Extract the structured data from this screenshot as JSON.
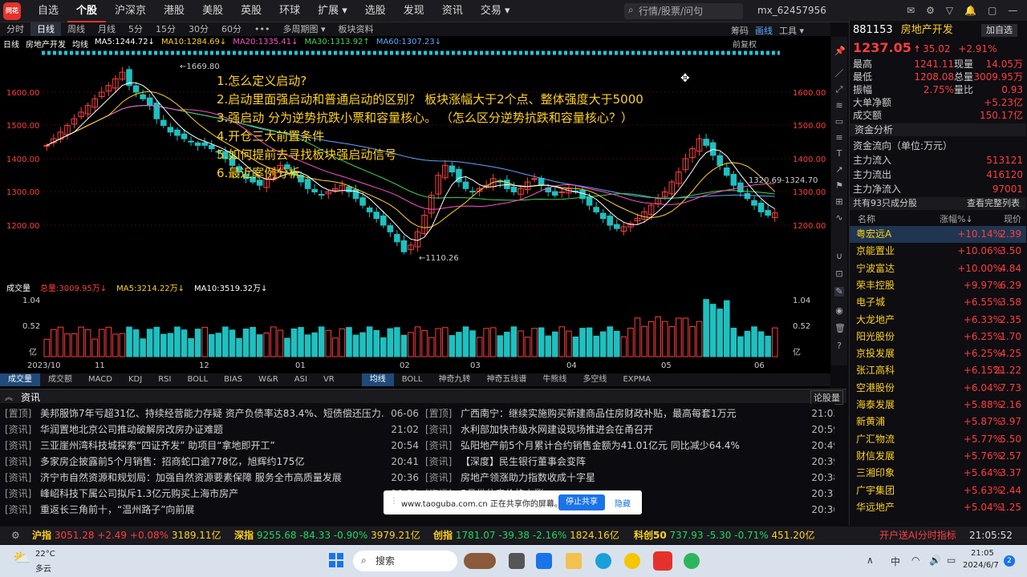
{
  "topbar": {
    "logo": "同花顺",
    "nav": [
      "自选",
      "个股",
      "沪深京",
      "港股",
      "美股",
      "英股",
      "环球",
      "扩展 ▾",
      "选股",
      "发现",
      "资讯",
      "交易 ▾"
    ],
    "search_placeholder": "行情/股票/问句",
    "user": "mx_62457956",
    "window_controls": [
      "✉",
      "⚙",
      "▽",
      "🔔",
      "▢",
      "—",
      "☐",
      "✕"
    ]
  },
  "periods": [
    "分时",
    "日线",
    "周线",
    "月线",
    "5分",
    "15分",
    "30分",
    "60分",
    "•••",
    "多周期图 ▾",
    "板块资料"
  ],
  "chart_tools": [
    "筹码",
    "画线",
    "工具 ▾"
  ],
  "ma_bar": {
    "label": "日线",
    "name": "房地产开发",
    "mode": "均线",
    "items": [
      {
        "text": "MA5:1244.72↓",
        "color": "#ffffff"
      },
      {
        "text": "MA10:1284.69↓",
        "color": "#ffd21a"
      },
      {
        "text": "MA20:1335.41↓",
        "color": "#ff4fc9"
      },
      {
        "text": "MA30:1313.92↑",
        "color": "#3dd65a"
      },
      {
        "text": "MA60:1307.23↓",
        "color": "#5aa8ff"
      }
    ],
    "right_label": "前复权"
  },
  "price_axis": [
    "1600.00",
    "1500.00",
    "1400.00",
    "1300.00",
    "1200.00"
  ],
  "annotations": {
    "high": "←1669.80",
    "low": "←1110.26",
    "range": "1320.69-1324.70"
  },
  "notes": [
    "1.怎么定义启动?",
    "2.启动里面强启动和普通启动的区别？   板块涨幅大于2个点、整体强度大于5000",
    "3.强启动 分为逆势抗跌小票和容量核心。  （怎么区分逆势抗跌和容量核心？）",
    "4.开仓三大前置条件",
    "5.如何提前去寻找板块强启动信号",
    "6.最近案例分析"
  ],
  "volume_bar": {
    "label": "成交量",
    "items": [
      {
        "text": "总量:3009.95万↓",
        "color": "#ff3d3d"
      },
      {
        "text": "MA5:3214.22万↓",
        "color": "#ffd21a"
      },
      {
        "text": "MA10:3519.32万↓",
        "color": "#ffffff"
      }
    ],
    "axis": [
      "1.04",
      "0.52",
      "亿"
    ]
  },
  "date_axis": [
    "2023/10",
    "11",
    "12",
    "01",
    "02",
    "03",
    "04",
    "05",
    "06"
  ],
  "indicator_tabs_left": [
    "成交量",
    "成交额",
    "MACD",
    "KDJ",
    "RSI",
    "BOLL",
    "BIAS",
    "W&R",
    "ASI",
    "VR"
  ],
  "indicator_tabs_right": [
    "均线",
    "BOLL",
    "神奇九转",
    "神奇五线谱",
    "牛熊线",
    "多空线",
    "EXPMA"
  ],
  "news_header": {
    "title": "资讯",
    "button": "论股量"
  },
  "news_left": [
    {
      "tag": "[置顶]",
      "text": "美邦服饰7年亏超31亿、持续经营能力存疑 资产负债率达83.4%、短债偿还压力...",
      "time": "06-06"
    },
    {
      "tag": "[资讯]",
      "text": "华润置地北京公司推动破解房改房办证难题",
      "time": "21:02"
    },
    {
      "tag": "[资讯]",
      "text": "三亚崖州湾科技城探索“四证齐发” 助项目“拿地即开工”",
      "time": "20:54"
    },
    {
      "tag": "[资讯]",
      "text": "多家房企披露前5个月销售：招商蛇口逾778亿，旭辉约175亿",
      "time": "20:41"
    },
    {
      "tag": "[资讯]",
      "text": "济宁市自然资源和规划局：加强自然资源要素保障 服务全市高质量发展",
      "time": "20:36"
    },
    {
      "tag": "[资讯]",
      "text": "峰岹科技下属公司拟斥1.3亿元购买上海市房产",
      "time": "20:31"
    },
    {
      "tag": "[资讯]",
      "text": "重返长三角前十，“温州路子”向前展",
      "time": "20:30"
    }
  ],
  "news_right": [
    {
      "tag": "[置顶]",
      "text": "广西南宁：继续实施购买新建商品住房财政补贴，最高每套1万元",
      "time": "21:03"
    },
    {
      "tag": "[资讯]",
      "text": "水利部加快市级水网建设现场推进会在甬召开",
      "time": "20:59"
    },
    {
      "tag": "[资讯]",
      "text": "弘阳地产前5个月累计合约销售金额为41.01亿元 同比减少64.4%",
      "time": "20:49"
    },
    {
      "tag": "[资讯]",
      "text": "【深度】民生银行董事会变阵",
      "time": "20:39"
    },
    {
      "tag": "[资讯]",
      "text": "房地产领涨助力指数收成十字星",
      "time": "20:38"
    },
    {
      "tag": "[资讯]",
      "text": "5月份住房价格上涨",
      "time": "20:31"
    },
    {
      "tag": "[资讯]",
      "text": "早偿率维持高位，首批保险资管交...",
      "time": "20:30"
    }
  ],
  "share_bar": {
    "text": "www.taoguba.com.cn 正在共享你的屏幕。",
    "stop": "停止共享",
    "hide": "隐藏"
  },
  "index_bar": [
    {
      "name": "沪指",
      "vals": [
        "3051.28",
        "+2.49",
        "+0.08%",
        "3189.11亿"
      ],
      "color": "#ff3d3d"
    },
    {
      "name": "深指",
      "vals": [
        "9255.68",
        "-84.33",
        "-0.90%",
        "3979.21亿"
      ],
      "color": "#1ed760"
    },
    {
      "name": "创指",
      "vals": [
        "1781.07",
        "-39.38",
        "-2.16%",
        "1824.16亿"
      ],
      "color": "#1ed760"
    },
    {
      "name": "科创50",
      "vals": [
        "737.93",
        "-5.30",
        "-0.71%",
        "451.20亿"
      ],
      "color": "#1ed760"
    }
  ],
  "index_bar_right": {
    "promo": "开户送AI分时指标",
    "time": "21:05:52"
  },
  "right_panel": {
    "code": "881153",
    "name": "房地产开发",
    "add": "加自选",
    "price": "1237.05",
    "change": "35.02",
    "pct": "+2.91%",
    "stats": [
      {
        "l": "最高",
        "v": "1241.11",
        "l2": "现量",
        "v2": "14.05万"
      },
      {
        "l": "最低",
        "v": "1208.08",
        "l2": "总量",
        "v2": "3009.95万"
      },
      {
        "l": "振幅",
        "v": "2.75%",
        "l2": "量比",
        "v2": "0.93"
      },
      {
        "l": "大单净额",
        "v": "",
        "l2": "",
        "v2": "+5.23亿"
      },
      {
        "l": "成交额",
        "v": "",
        "l2": "",
        "v2": "150.17亿"
      }
    ],
    "fund_title": "资金分析",
    "fund_unit": "资金流向（单位:万元）",
    "funds": [
      {
        "l": "主力流入",
        "v": "513121"
      },
      {
        "l": "主力流出",
        "v": "416120"
      },
      {
        "l": "主力净流入",
        "v": "97001"
      }
    ],
    "members_title": "共有93只成分股",
    "members_btn": "查看完整列表",
    "cols": [
      "名称",
      "涨幅%↓",
      "现价"
    ],
    "stocks": [
      {
        "n": "粤宏远A",
        "p": "+10.14%",
        "c": "2.39"
      },
      {
        "n": "京能置业",
        "p": "+10.06%",
        "c": "3.50"
      },
      {
        "n": "宁波富达",
        "p": "+10.00%",
        "c": "4.84"
      },
      {
        "n": "荣丰控股",
        "p": "+9.97%",
        "c": "6.29"
      },
      {
        "n": "电子城",
        "p": "+6.55%",
        "c": "3.58"
      },
      {
        "n": "大龙地产",
        "p": "+6.33%",
        "c": "2.35"
      },
      {
        "n": "阳光股份",
        "p": "+6.25%",
        "c": "1.70"
      },
      {
        "n": "京投发展",
        "p": "+6.25%",
        "c": "4.25"
      },
      {
        "n": "张江高科",
        "p": "+6.15%",
        "c": "21.22"
      },
      {
        "n": "空港股份",
        "p": "+6.04%",
        "c": "7.73"
      },
      {
        "n": "海泰发展",
        "p": "+5.88%",
        "c": "2.16"
      },
      {
        "n": "新黄浦",
        "p": "+5.87%",
        "c": "3.97"
      },
      {
        "n": "广汇物流",
        "p": "+5.77%",
        "c": "5.50"
      },
      {
        "n": "财信发展",
        "p": "+5.76%",
        "c": "2.57"
      },
      {
        "n": "三湘印象",
        "p": "+5.64%",
        "c": "3.37"
      },
      {
        "n": "广宇集团",
        "p": "+5.63%",
        "c": "2.44"
      },
      {
        "n": "华远地产",
        "p": "+5.04%",
        "c": "1.25"
      }
    ]
  },
  "taskbar": {
    "weather_temp": "22°C",
    "weather_desc": "多云",
    "search": "搜索",
    "ime": "中",
    "time": "21:05",
    "date": "2024/6/7",
    "badge": "2"
  }
}
